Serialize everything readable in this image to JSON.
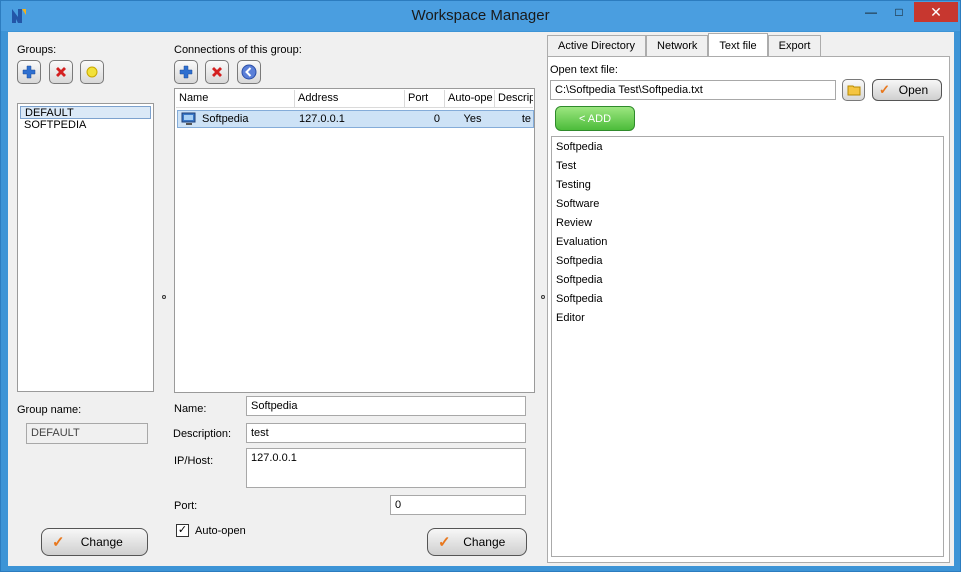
{
  "window": {
    "title": "Workspace Manager",
    "minimize_glyph": "—",
    "maximize_glyph": "□",
    "close_glyph": "✕"
  },
  "groups": {
    "label": "Groups:",
    "items": [
      "DEFAULT",
      "SOFTPEDIA"
    ],
    "selected_index": 0,
    "group_name_label": "Group name:",
    "group_name_value": "DEFAULT",
    "change_label": "Change"
  },
  "connections": {
    "label": "Connections of this group:",
    "columns": [
      "Name",
      "Address",
      "Port",
      "Auto-ope",
      "Descrip"
    ],
    "rows": [
      {
        "name": "Softpedia",
        "address": "127.0.0.1",
        "port": "0",
        "auto_open": "Yes",
        "description": "te"
      }
    ],
    "name_label": "Name:",
    "name_value": "Softpedia",
    "description_label": "Description:",
    "description_value": "test",
    "host_label": "IP/Host:",
    "host_value": "127.0.0.1",
    "port_label": "Port:",
    "port_value": "0",
    "auto_open_label": "Auto-open",
    "auto_open_checked": true,
    "change_label": "Change"
  },
  "tabs": [
    "Active Directory",
    "Network",
    "Text file",
    "Export"
  ],
  "active_tab": "Text file",
  "textfile": {
    "open_label": "Open text file:",
    "path": "C:\\Softpedia Test\\Softpedia.txt",
    "open_button": "Open",
    "add_button": "< ADD",
    "lines": [
      "Softpedia",
      "Test",
      "Testing",
      "Software",
      "Review",
      "Evaluation",
      "Softpedia",
      "Softpedia",
      "Softpedia",
      "Editor"
    ]
  },
  "colors": {
    "title_bar": "#4a9ee0",
    "close_button": "#c7372f",
    "add_button_green": "#4cbc3a",
    "selection": "#cde2f6",
    "check_orange": "#e8781e"
  }
}
